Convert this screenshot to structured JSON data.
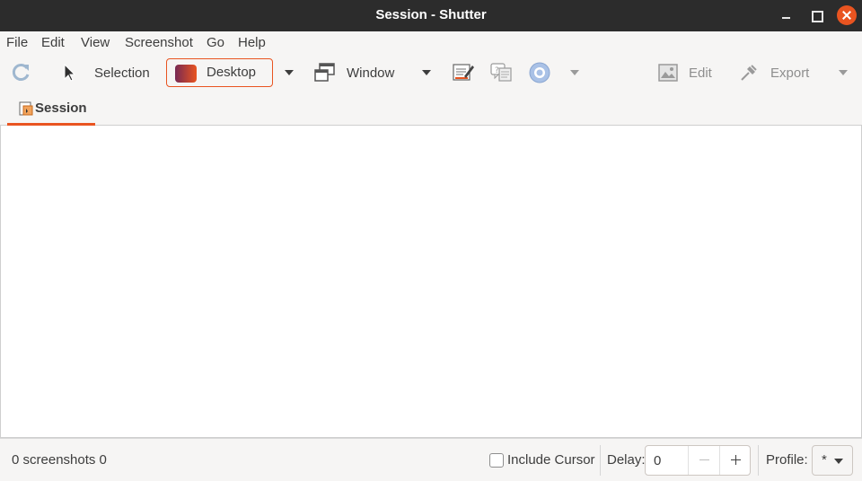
{
  "window": {
    "title": "Session - Shutter"
  },
  "menubar": {
    "items": [
      "File",
      "Edit",
      "View",
      "Screenshot",
      "Go",
      "Help"
    ]
  },
  "toolbar": {
    "selection_label": "Selection",
    "desktop_label": "Desktop",
    "window_label": "Window",
    "edit_label": "Edit",
    "export_label": "Export"
  },
  "tabs": [
    {
      "label": "Session"
    }
  ],
  "statusbar": {
    "screenshot_count": "0 screenshots  0",
    "include_cursor_label": "Include Cursor",
    "include_cursor_checked": false,
    "delay_label": "Delay:",
    "delay_value": "0",
    "profile_label": "Profile:",
    "profile_value": "*"
  },
  "colors": {
    "accent": "#e95420",
    "titlebar": "#2c2c2c",
    "background": "#f6f5f4"
  }
}
